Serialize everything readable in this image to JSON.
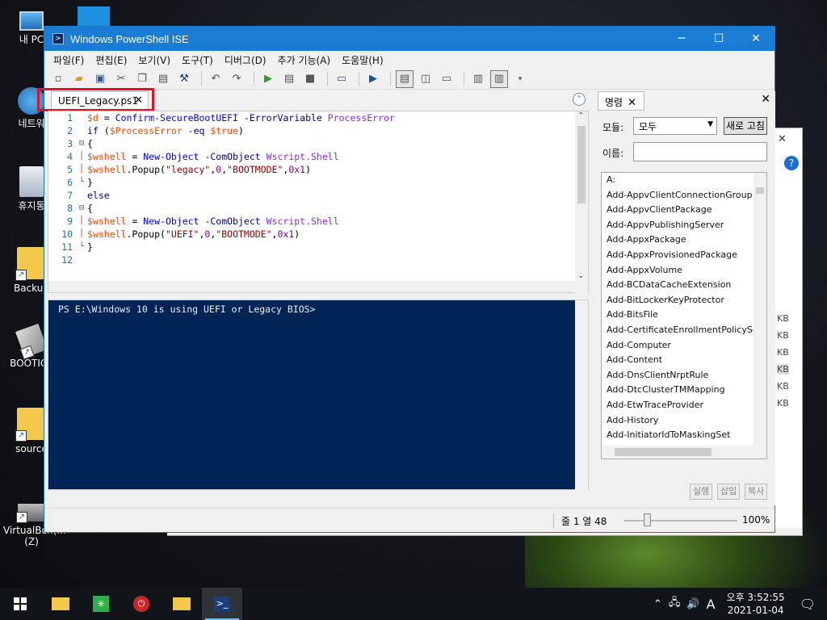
{
  "desktop": {
    "icons": [
      "내 PC",
      "네트워",
      "휴지통",
      "Backup",
      "BOOTICE",
      "source",
      "VirtualBox(...\n(Z)"
    ]
  },
  "window": {
    "title": "Windows PowerShell ISE",
    "minimize": "─",
    "maximize": "☐",
    "close": "✕"
  },
  "menu": [
    "파일(F)",
    "편집(E)",
    "보기(V)",
    "도구(T)",
    "디버그(D)",
    "추가 기능(A)",
    "도움말(H)"
  ],
  "tab": {
    "label": "UEFI_Legacy.ps1",
    "close": "✕"
  },
  "editor": {
    "line_numbers": [
      "1",
      "2",
      "3",
      "4",
      "5",
      "6",
      "7",
      "8",
      "9",
      "10",
      "11",
      "12"
    ],
    "lines": [
      "$d = Confirm-SecureBootUEFI -ErrorVariable ProcessError",
      "if ($ProcessError -eq $true)",
      "{",
      "$wshell = New-Object -ComObject Wscript.Shell",
      "$wshell.Popup(\"legacy\",0,\"BOOTMODE\",0x1)",
      "}",
      "else",
      "{",
      "$wshell = New-Object -ComObject Wscript.Shell",
      "$wshell.Popup(\"UEFI\",0,\"BOOTMODE\",0x1)",
      "}",
      ""
    ]
  },
  "console": {
    "prompt": "PS E:\\Windows 10 is using UEFI or Legacy BIOS>"
  },
  "command_pane": {
    "tab_label": "명령",
    "tab_close": "✕",
    "pane_close": "✕",
    "module_label": "모듈:",
    "module_value": "모두",
    "refresh_button": "새로 고침",
    "name_label": "이름:",
    "name_value": "",
    "commands": [
      "A:",
      "Add-AppvClientConnectionGroup",
      "Add-AppvClientPackage",
      "Add-AppvPublishingServer",
      "Add-AppxPackage",
      "Add-AppxProvisionedPackage",
      "Add-AppxVolume",
      "Add-BCDataCacheExtension",
      "Add-BitLockerKeyProtector",
      "Add-BitsFile",
      "Add-CertificateEnrollmentPolicyServ",
      "Add-Computer",
      "Add-Content",
      "Add-DnsClientNrptRule",
      "Add-DtcClusterTMMapping",
      "Add-EtwTraceProvider",
      "Add-History",
      "Add-InitiatorIdToMaskingSet"
    ],
    "buttons": {
      "run": "실행",
      "insert": "삽입",
      "copy": "복사"
    }
  },
  "status": {
    "position": "줄 1  열 48",
    "zoom": "100%",
    "zoom_level_percent": 100
  },
  "back_window_sizes": [
    "KB",
    "KB",
    "KB",
    "KB",
    "KB",
    "KB"
  ],
  "taskbar": {
    "ime": "A",
    "time": "오후 3:52:55",
    "date": "2021-01-04"
  }
}
